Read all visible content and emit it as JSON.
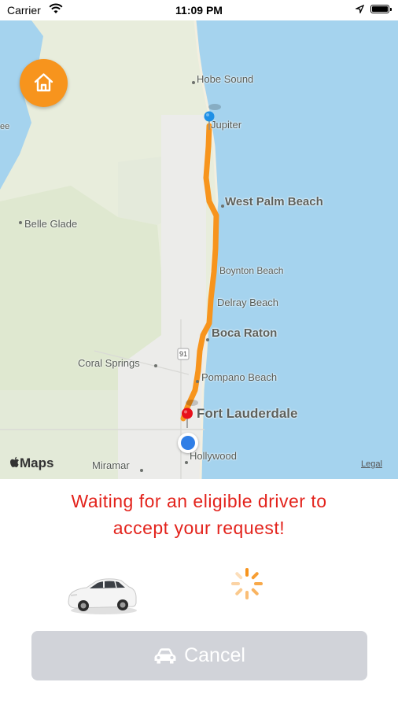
{
  "status_bar": {
    "carrier": "Carrier",
    "time": "11:09 PM"
  },
  "map": {
    "places": {
      "hobe_sound": "Hobe Sound",
      "jupiter": "Jupiter",
      "west_palm_beach": "West Palm Beach",
      "belle_glade": "Belle Glade",
      "boynton_beach": "Boynton Beach",
      "delray_beach": "Delray Beach",
      "boca_raton": "Boca Raton",
      "coral_springs": "Coral Springs",
      "pompano_beach": "Pompano Beach",
      "fort_lauderdale": "Fort Lauderdale",
      "hollywood": "Hollywood",
      "miramar": "Miramar",
      "lake_partial": "ee",
      "highway_shield": "91"
    },
    "maps_logo": "Maps",
    "legal": "Legal",
    "route_color": "#f7941d"
  },
  "waiting_message_line1": "Waiting for an eligible driver to",
  "waiting_message_line2": "accept your request!",
  "cancel_button": {
    "label": "Cancel"
  },
  "colors": {
    "accent": "#f7941d",
    "message": "#e3231c",
    "button_bg": "#d1d3d9"
  }
}
